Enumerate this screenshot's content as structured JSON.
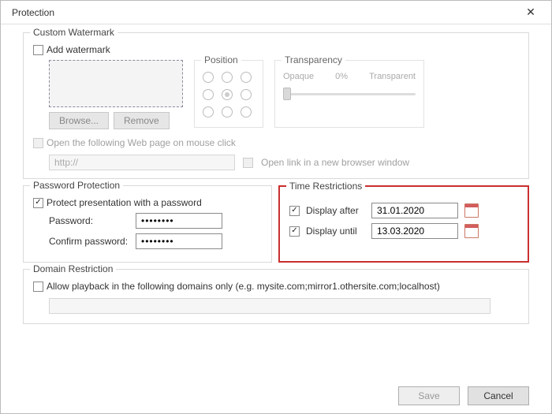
{
  "dialog": {
    "title": "Protection"
  },
  "watermark": {
    "legend": "Custom Watermark",
    "add_label": "Add watermark",
    "add_checked": false,
    "browse_label": "Browse...",
    "remove_label": "Remove",
    "position_label": "Position",
    "position_selected": 4,
    "transparency_label": "Transparency",
    "opaque_label": "Opaque",
    "percent_label": "0%",
    "transparent_label": "Transparent",
    "weblink_label": "Open the following Web page on mouse click",
    "weblink_value": "http://",
    "newwin_label": "Open link in a new browser window"
  },
  "password": {
    "legend": "Password Protection",
    "protect_label": "Protect presentation with a password",
    "protect_checked": true,
    "password_label": "Password:",
    "password_value": "••••••••",
    "confirm_label": "Confirm password:",
    "confirm_value": "••••••••"
  },
  "time": {
    "legend": "Time Restrictions",
    "after_label": "Display after",
    "after_checked": true,
    "after_value": "31.01.2020",
    "until_label": "Display until",
    "until_checked": true,
    "until_value": "13.03.2020"
  },
  "domain": {
    "legend": "Domain Restriction",
    "allow_label": "Allow playback in the following domains only (e.g. mysite.com;mirror1.othersite.com;localhost)",
    "allow_checked": false,
    "value": ""
  },
  "footer": {
    "save_label": "Save",
    "cancel_label": "Cancel"
  }
}
